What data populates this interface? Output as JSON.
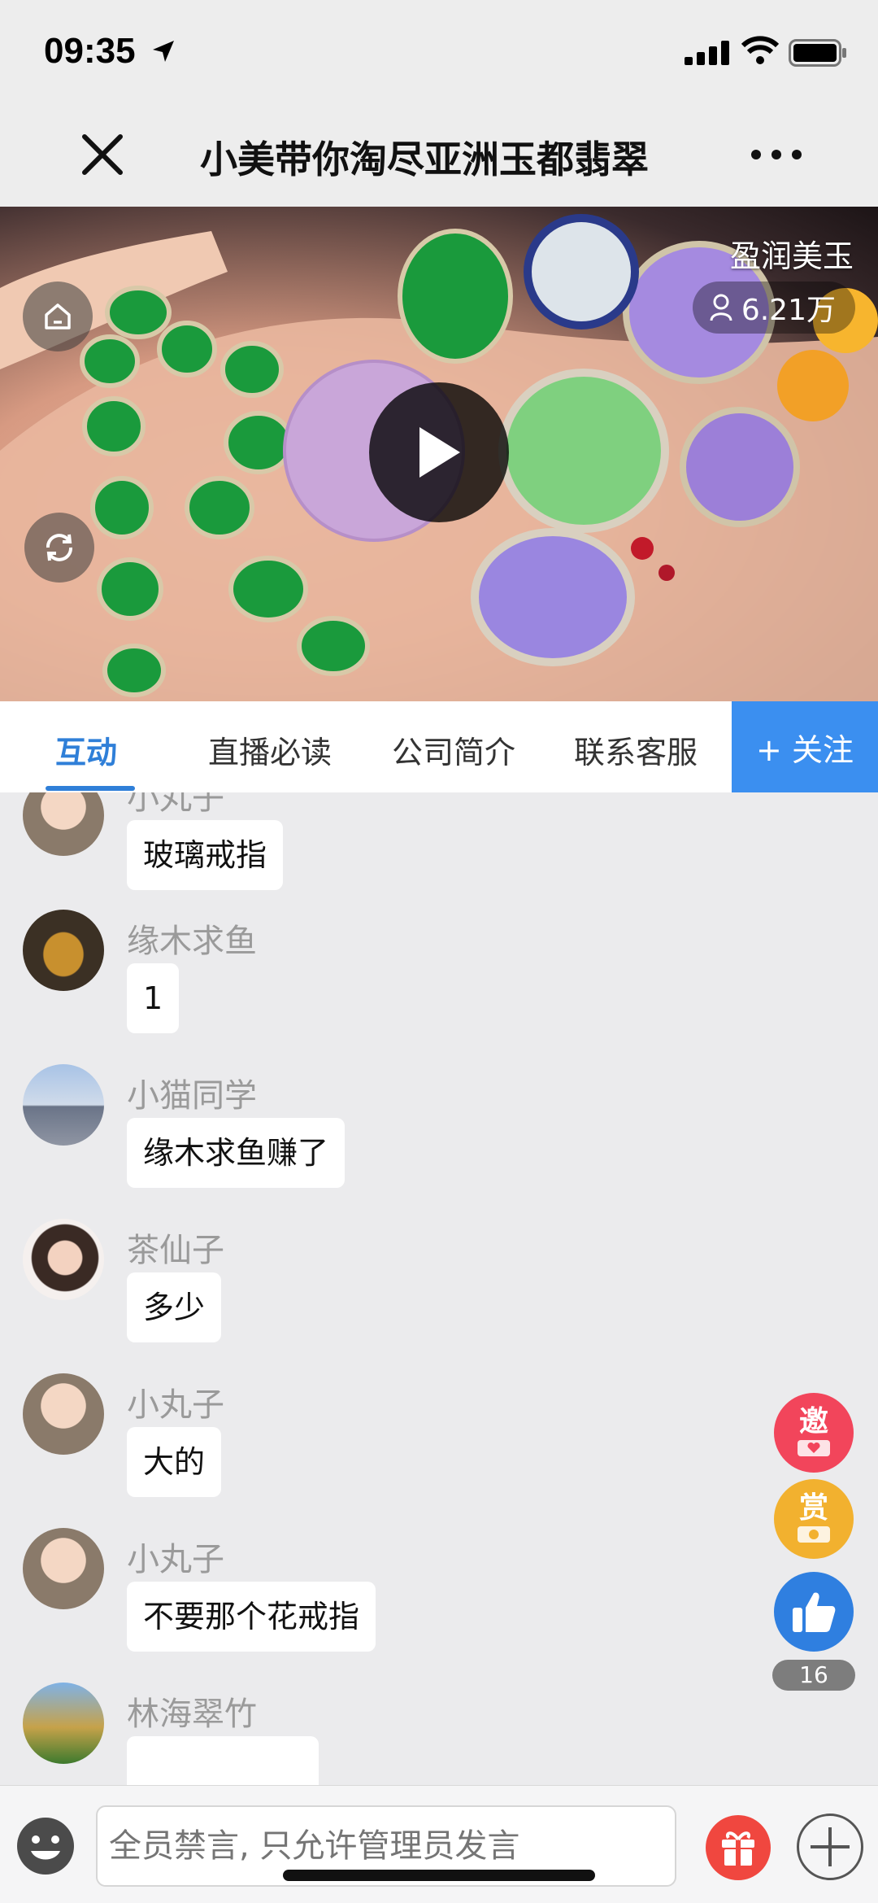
{
  "status": {
    "time": "09:35"
  },
  "nav": {
    "title": "小美带你淘尽亚洲玉都翡翠",
    "close_icon": "close-icon",
    "more_icon": "more-icon"
  },
  "video": {
    "anchor": "盈润美玉",
    "viewers": "6.21万"
  },
  "tabs": [
    {
      "label": "互动",
      "active": true
    },
    {
      "label": "直播必读",
      "active": false
    },
    {
      "label": "公司简介",
      "active": false
    },
    {
      "label": "联系客服",
      "active": false
    }
  ],
  "follow_label": "+ 关注",
  "messages": [
    {
      "name": "小丸子",
      "text": "玻璃戒指"
    },
    {
      "name": "缘木求鱼",
      "text": "1"
    },
    {
      "name": "小猫同学",
      "text": "缘木求鱼赚了"
    },
    {
      "name": "茶仙子",
      "text": "多少"
    },
    {
      "name": "小丸子",
      "text": "大的"
    },
    {
      "name": "小丸子",
      "text": "不要那个花戒指"
    },
    {
      "name": "林海翠竹",
      "text": ""
    }
  ],
  "side": {
    "invite": "邀",
    "reward": "赏",
    "like_count": "16"
  },
  "input": {
    "placeholder": "全员禁言, 只允许管理员发言"
  },
  "colors": {
    "accent": "#2f7fd8",
    "follow": "#3b8ff0",
    "invite": "#f2455b",
    "reward": "#f2b12f",
    "gift": "#f0473f"
  }
}
